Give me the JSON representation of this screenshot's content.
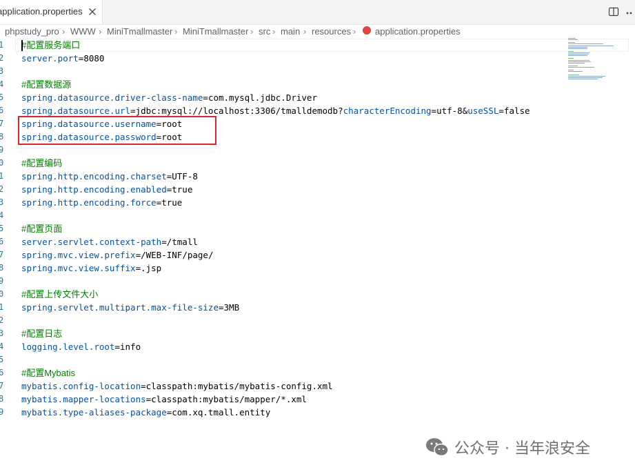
{
  "tab": {
    "label": "application.properties"
  },
  "breadcrumb": [
    "phpstudy_pro",
    "WWW",
    "MiniTmallmaster",
    "MiniTmallmaster",
    "src",
    "main",
    "resources",
    "application.properties"
  ],
  "lines": [
    {
      "n": "1",
      "type": "comment",
      "text": "#配置服务端口"
    },
    {
      "n": "2",
      "type": "kv",
      "key": "server.port",
      "value": "8080"
    },
    {
      "n": "3",
      "type": "blank"
    },
    {
      "n": "4",
      "type": "comment",
      "text": "#配置数据源"
    },
    {
      "n": "5",
      "type": "kv",
      "key": "spring.datasource.driver-class-name",
      "value": "com.mysql.jdbc.Driver"
    },
    {
      "n": "6",
      "type": "url",
      "key": "spring.datasource.url",
      "p1": "jdbc:mysql://localhost:3306/tmalldemodb?",
      "k2": "characterEncoding",
      "p2": "=utf-8&",
      "k3": "useSSL",
      "p3": "=false"
    },
    {
      "n": "7",
      "type": "kv",
      "key": "spring.datasource.username",
      "value": "root"
    },
    {
      "n": "8",
      "type": "kv",
      "key": "spring.datasource.password",
      "value": "root"
    },
    {
      "n": "9",
      "type": "blank"
    },
    {
      "n": "0",
      "type": "comment",
      "text": "#配置编码"
    },
    {
      "n": "1",
      "type": "kv",
      "key": "spring.http.encoding.charset",
      "value": "UTF-8"
    },
    {
      "n": "2",
      "type": "kv",
      "key": "spring.http.encoding.enabled",
      "value": "true"
    },
    {
      "n": "3",
      "type": "kv",
      "key": "spring.http.encoding.force",
      "value": "true"
    },
    {
      "n": "4",
      "type": "blank"
    },
    {
      "n": "5",
      "type": "comment",
      "text": "#配置页面"
    },
    {
      "n": "6",
      "type": "kv",
      "key": "server.servlet.context-path",
      "value": "/tmall"
    },
    {
      "n": "7",
      "type": "kv",
      "key": "spring.mvc.view.prefix",
      "value": "/WEB-INF/page/"
    },
    {
      "n": "8",
      "type": "kv",
      "key": "spring.mvc.view.suffix",
      "value": ".jsp"
    },
    {
      "n": "9",
      "type": "blank"
    },
    {
      "n": "0",
      "type": "comment",
      "text": "#配置上传文件大小"
    },
    {
      "n": "1",
      "type": "kv",
      "key": "spring.servlet.multipart.max-file-size",
      "value": "3MB"
    },
    {
      "n": "2",
      "type": "blank"
    },
    {
      "n": "3",
      "type": "comment",
      "text": "#配置日志"
    },
    {
      "n": "4",
      "type": "kv",
      "key": "logging.level.root",
      "value": "info"
    },
    {
      "n": "5",
      "type": "blank"
    },
    {
      "n": "6",
      "type": "comment",
      "text": "#配置Mybatis"
    },
    {
      "n": "7",
      "type": "kv",
      "key": "mybatis.config-location",
      "value": "classpath:mybatis/mybatis-config.xml"
    },
    {
      "n": "8",
      "type": "kv",
      "key": "mybatis.mapper-locations",
      "value": "classpath:mybatis/mapper/*.xml"
    },
    {
      "n": "9",
      "type": "kv",
      "key": "mybatis.type-aliases-package",
      "value": "com.xq.tmall.entity"
    }
  ],
  "watermark": {
    "text": "公众号 · 当年浪安全"
  },
  "colors": {
    "comment": "#008000",
    "key": "#0451a5",
    "line_number": "#237893",
    "highlight_box": "#d8262d"
  }
}
